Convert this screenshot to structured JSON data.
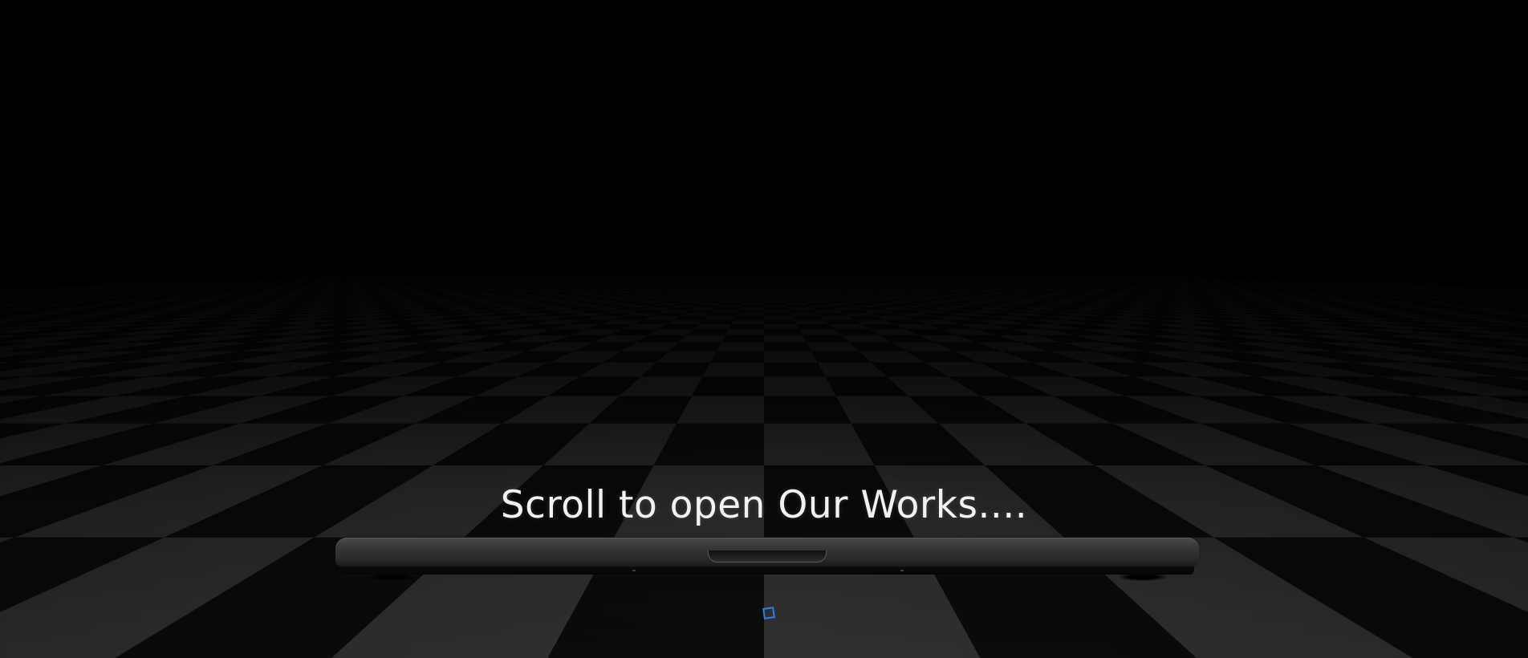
{
  "hero": {
    "scroll_hint": "Scroll to open Our Works...."
  },
  "colors": {
    "background": "#000000",
    "text": "#f2f2f2",
    "floor_light": "#3a3a3a",
    "floor_dark": "#0e0e0e",
    "cursor_accent": "#2f7de1",
    "laptop_body": "#3a3a3a"
  },
  "icons": {
    "cursor": "scroll-cursor-icon"
  }
}
